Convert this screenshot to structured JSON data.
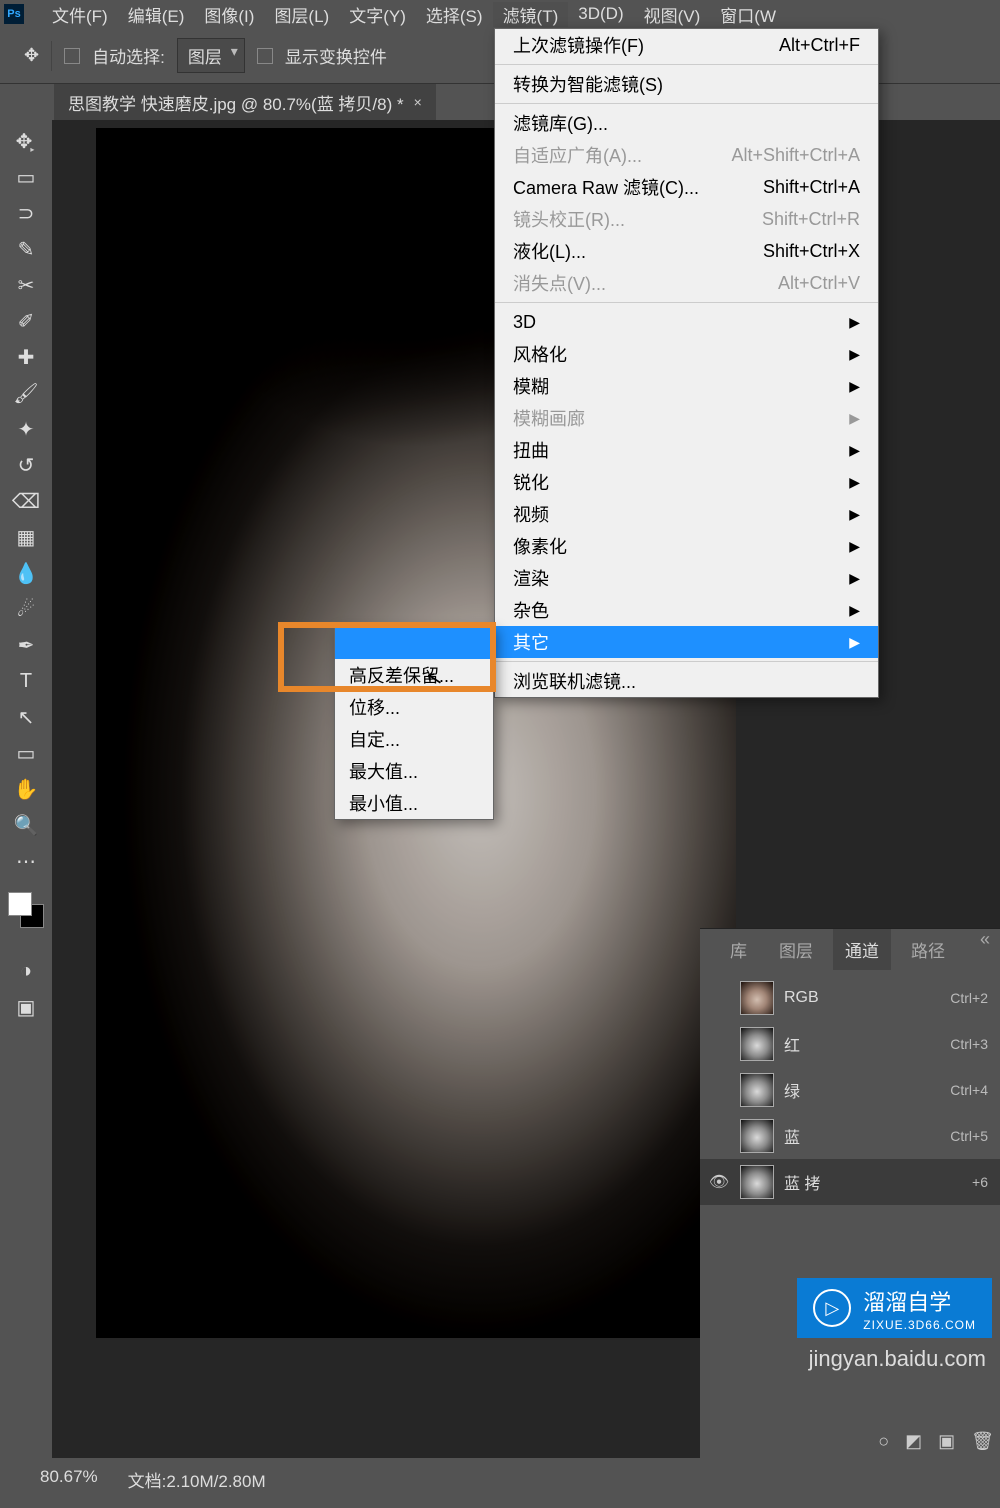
{
  "menubar": [
    "文件(F)",
    "编辑(E)",
    "图像(I)",
    "图层(L)",
    "文字(Y)",
    "选择(S)",
    "滤镜(T)",
    "3D(D)",
    "视图(V)",
    "窗口(W"
  ],
  "menubar_active_index": 6,
  "options": {
    "auto_select_label": "自动选择:",
    "layer_select": "图层",
    "show_transform": "显示变换控件"
  },
  "document_tab": {
    "title": "思图教学 快速磨皮.jpg @ 80.7%(蓝 拷贝/8) *",
    "close": "×"
  },
  "filter_menu": [
    {
      "label": "上次滤镜操作(F)",
      "shortcut": "Alt+Ctrl+F"
    },
    {
      "sep": true
    },
    {
      "label": "转换为智能滤镜(S)"
    },
    {
      "sep": true
    },
    {
      "label": "滤镜库(G)..."
    },
    {
      "label": "自适应广角(A)...",
      "shortcut": "Alt+Shift+Ctrl+A",
      "disabled": true
    },
    {
      "label": "Camera Raw 滤镜(C)...",
      "shortcut": "Shift+Ctrl+A"
    },
    {
      "label": "镜头校正(R)...",
      "shortcut": "Shift+Ctrl+R",
      "disabled": true
    },
    {
      "label": "液化(L)...",
      "shortcut": "Shift+Ctrl+X"
    },
    {
      "label": "消失点(V)...",
      "shortcut": "Alt+Ctrl+V",
      "disabled": true
    },
    {
      "sep": true
    },
    {
      "label": "3D",
      "submenu": true
    },
    {
      "label": "风格化",
      "submenu": true
    },
    {
      "label": "模糊",
      "submenu": true
    },
    {
      "label": "模糊画廊",
      "submenu": true,
      "disabled": true
    },
    {
      "label": "扭曲",
      "submenu": true
    },
    {
      "label": "锐化",
      "submenu": true
    },
    {
      "label": "视频",
      "submenu": true
    },
    {
      "label": "像素化",
      "submenu": true
    },
    {
      "label": "渲染",
      "submenu": true
    },
    {
      "label": "杂色",
      "submenu": true
    },
    {
      "label": "其它",
      "submenu": true,
      "highlighted": true
    },
    {
      "sep": true
    },
    {
      "label": "浏览联机滤镜..."
    }
  ],
  "other_submenu": [
    {
      "label": "",
      "highlighted": true
    },
    {
      "label": "高反差保留..."
    },
    {
      "label": "位移..."
    },
    {
      "label": "自定..."
    },
    {
      "label": "最大值..."
    },
    {
      "label": "最小值..."
    }
  ],
  "panel_tabs": [
    "库",
    "图层",
    "通道",
    "路径"
  ],
  "panel_active_index": 2,
  "channels": [
    {
      "name": "RGB",
      "shortcut": "Ctrl+2",
      "color": true
    },
    {
      "name": "红",
      "shortcut": "Ctrl+3"
    },
    {
      "name": "绿",
      "shortcut": "Ctrl+4"
    },
    {
      "name": "蓝",
      "shortcut": "Ctrl+5"
    },
    {
      "name": "蓝 拷",
      "shortcut": "+6",
      "selected": true,
      "eye": true
    }
  ],
  "status": {
    "zoom": "80.67%",
    "doc": "文档:2.10M/2.80M"
  },
  "watermark": {
    "brand": "溜溜自学",
    "sub": "ZIXUE.3D66.COM",
    "url": "jingyan.baidu.com"
  }
}
